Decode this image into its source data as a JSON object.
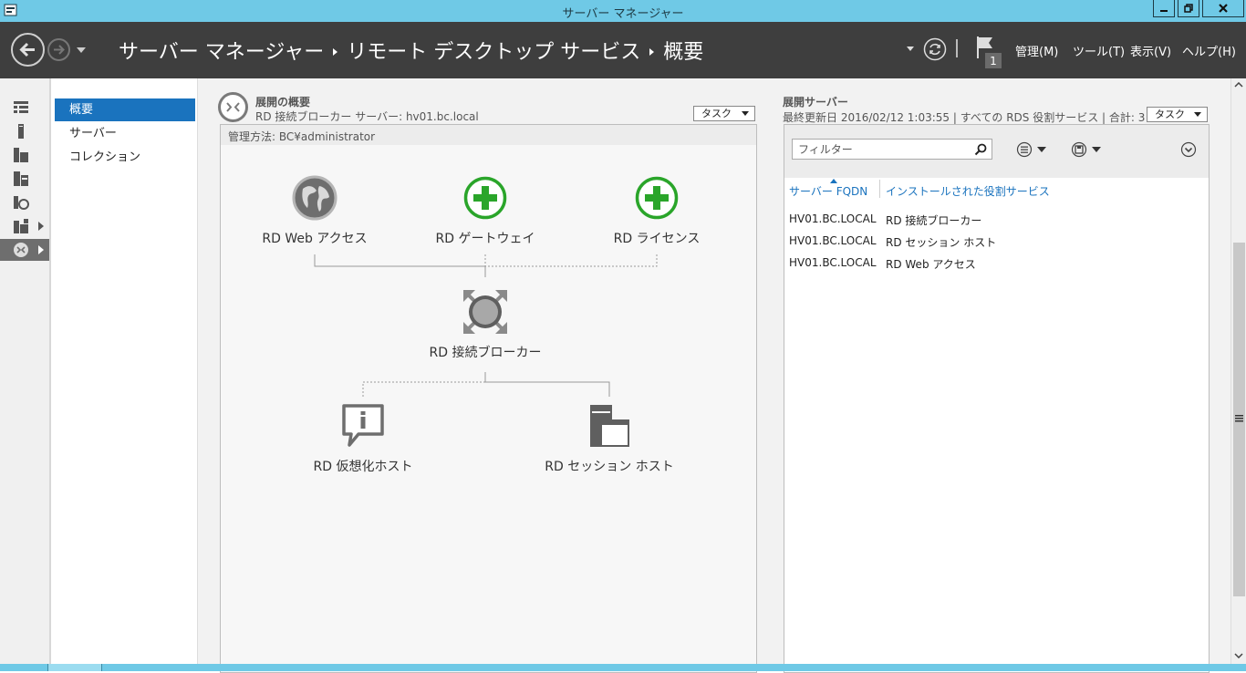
{
  "window": {
    "title": "サーバー マネージャー"
  },
  "header": {
    "breadcrumb": [
      "サーバー マネージャー",
      "リモート デスクトップ サービス",
      "概要"
    ],
    "notification_count": "1",
    "menus": [
      "管理(M)",
      "ツール(T)",
      "表示(V)",
      "ヘルプ(H)"
    ]
  },
  "rail": {
    "icons": [
      "dashboard-icon",
      "local-server-icon",
      "all-servers-icon",
      "file-storage-icon",
      "iis-icon",
      "rds-group-icon",
      "rds-icon"
    ]
  },
  "nav": {
    "items": [
      "概要",
      "サーバー",
      "コレクション"
    ],
    "active": "概要"
  },
  "overview": {
    "title": "展開の概要",
    "subtitle": "RD 接続ブローカー サーバー: hv01.bc.local",
    "task_label": "タスク",
    "manage_label": "管理方法: BC¥administrator",
    "roles": {
      "web": "RD Web アクセス",
      "gateway": "RD ゲートウェイ",
      "licensing": "RD ライセンス",
      "broker": "RD 接続ブローカー",
      "virtualization": "RD 仮想化ホスト",
      "session": "RD セッション ホスト"
    },
    "colors": {
      "add": "#2aa52a",
      "icon_gray": "#6e6e6e",
      "connector": "#999999"
    }
  },
  "servers": {
    "title": "展開サーバー",
    "subtitle": "最終更新日 2016/02/12 1:03:55 | すべての RDS 役割サービス | 合計: 3",
    "task_label": "タスク",
    "filter_placeholder": "フィルター",
    "columns": [
      "サーバー FQDN",
      "インストールされた役割サービス"
    ],
    "rows": [
      [
        "HV01.BC.LOCAL",
        "RD 接続ブローカー"
      ],
      [
        "HV01.BC.LOCAL",
        "RD セッション ホスト"
      ],
      [
        "HV01.BC.LOCAL",
        "RD Web アクセス"
      ]
    ]
  },
  "colors": {
    "titlebar": "#6fc9e6",
    "header": "#3e3e3e",
    "accent": "#1a73be"
  }
}
